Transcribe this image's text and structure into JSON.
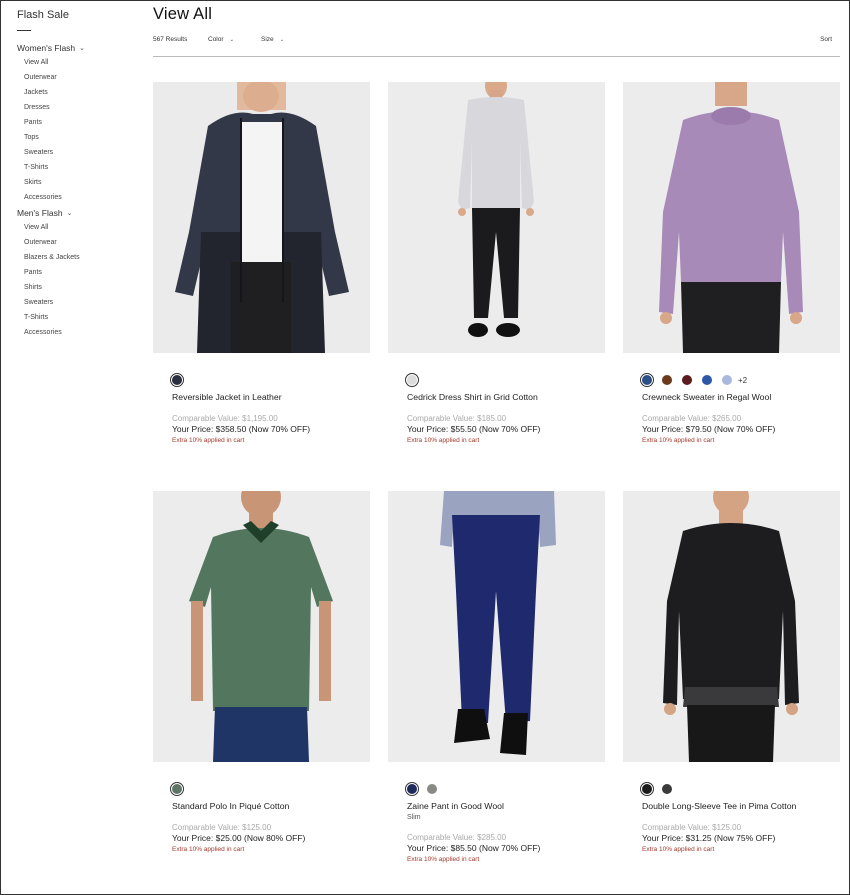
{
  "sidebar": {
    "title": "Flash Sale",
    "groups": [
      {
        "label": "Women's Flash",
        "items": [
          "View All",
          "Outerwear",
          "Jackets",
          "Dresses",
          "Pants",
          "Tops",
          "Sweaters",
          "T-Shirts",
          "Skirts",
          "Accessories"
        ]
      },
      {
        "label": "Men's Flash",
        "items": [
          "View All",
          "Outerwear",
          "Blazers & Jackets",
          "Pants",
          "Shirts",
          "Sweaters",
          "T-Shirts",
          "Accessories"
        ]
      }
    ]
  },
  "page": {
    "title": "View All"
  },
  "filters": {
    "results": "567 Results",
    "color": "Color",
    "size": "Size",
    "sort": "Sort"
  },
  "products": [
    {
      "name": "Reversible Jacket in Leather",
      "fit": "",
      "comparable": "Comparable Value: $1,195.00",
      "price": "Your Price: $358.50 (Now 70% OFF)",
      "extra": "Extra 10% applied in cart",
      "swatches": [
        "#2b2f3e"
      ],
      "more": ""
    },
    {
      "name": "Cedrick Dress Shirt in Grid Cotton",
      "fit": "",
      "comparable": "Comparable Value: $185.00",
      "price": "Your Price: $55.50 (Now 70% OFF)",
      "extra": "Extra 10% applied in cart",
      "swatches": [
        "#dcdcdc"
      ],
      "more": ""
    },
    {
      "name": "Crewneck Sweater in Regal Wool",
      "fit": "",
      "comparable": "Comparable Value: $265.00",
      "price": "Your Price: $79.50 (Now 70% OFF)",
      "extra": "Extra 10% applied in cart",
      "swatches": [
        "#2b4f86",
        "#6b3a1d",
        "#5a1c1c",
        "#2f57a8",
        "#a9b8dc"
      ],
      "more": "+2"
    },
    {
      "name": "Standard Polo In Piqué Cotton",
      "fit": "",
      "comparable": "Comparable Value: $125.00",
      "price": "Your Price: $25.00 (Now 80% OFF)",
      "extra": "Extra 10% applied in cart",
      "swatches": [
        "#5c7566"
      ],
      "more": ""
    },
    {
      "name": "Zaine Pant in Good Wool",
      "fit": "Slim",
      "comparable": "Comparable Value: $285.00",
      "price": "Your Price: $85.50 (Now 70% OFF)",
      "extra": "Extra 10% applied in cart",
      "swatches": [
        "#1e2a5c",
        "#8a8a85"
      ],
      "more": ""
    },
    {
      "name": "Double Long-Sleeve Tee in Pima Cotton",
      "fit": "",
      "comparable": "Comparable Value: $125.00",
      "price": "Your Price: $31.25 (Now 75% OFF)",
      "extra": "Extra 10% applied in cart",
      "swatches": [
        "#1b1b1b",
        "#3a3a3a"
      ],
      "more": ""
    }
  ]
}
